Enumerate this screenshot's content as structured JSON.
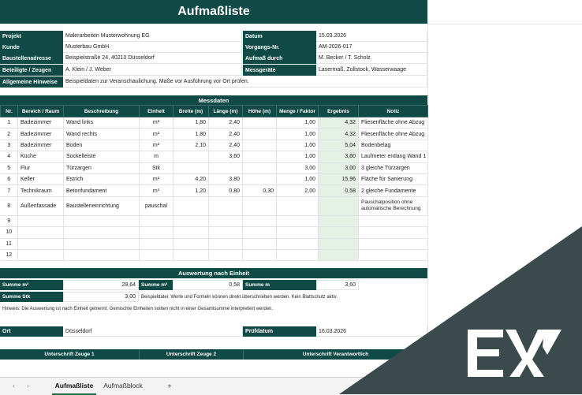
{
  "title": "Aufmaßliste",
  "info": {
    "left": [
      {
        "label": "Projekt",
        "value": "Malerarbeiten Musterwohnung EG"
      },
      {
        "label": "Kunde",
        "value": "Musterbau GmbH"
      },
      {
        "label": "Baustellenadresse",
        "value": "Beispielstraße 24, 40210 Düsseldorf"
      },
      {
        "label": "Beteiligte / Zeugen",
        "value": "A. Klein / J. Weber"
      }
    ],
    "right": [
      {
        "label": "Datum",
        "value": "15.03.2026"
      },
      {
        "label": "Vorgangs-Nr.",
        "value": "AM-2026-017"
      },
      {
        "label": "Aufmaß durch",
        "value": "M. Becker / T. Scholz"
      },
      {
        "label": "Messgeräte",
        "value": "Lasermaß, Zollstock, Wasserwaage"
      }
    ],
    "hinweise_label": "Allgemeine Hinweise",
    "hinweise_value": "Beispieldaten zur Veranschaulichung. Maße vor Ausführung vor Ort prüfen."
  },
  "messdaten": {
    "title": "Messdaten",
    "columns": [
      "Nr.",
      "Bereich / Raum",
      "Beschreibung",
      "Einheit",
      "Breite (m)",
      "Länge (m)",
      "Höhe (m)",
      "Menge / Faktor",
      "Ergebnis",
      "Notiz"
    ],
    "rows": [
      {
        "nr": "1",
        "bereich": "Badezimmer",
        "beschreibung": "Wand links",
        "einheit": "m²",
        "breite": "1,80",
        "laenge": "2,40",
        "hoehe": "",
        "menge": "1,00",
        "ergebnis": "4,32",
        "notiz": "Fliesenfläche ohne Abzug"
      },
      {
        "nr": "2",
        "bereich": "Badezimmer",
        "beschreibung": "Wand rechts",
        "einheit": "m²",
        "breite": "1,80",
        "laenge": "2,40",
        "hoehe": "",
        "menge": "1,00",
        "ergebnis": "4,32",
        "notiz": "Fliesenfläche ohne Abzug"
      },
      {
        "nr": "3",
        "bereich": "Badezimmer",
        "beschreibung": "Boden",
        "einheit": "m²",
        "breite": "2,10",
        "laenge": "2,40",
        "hoehe": "",
        "menge": "1,00",
        "ergebnis": "5,04",
        "notiz": "Bodenbelag"
      },
      {
        "nr": "4",
        "bereich": "Küche",
        "beschreibung": "Sockelleiste",
        "einheit": "m",
        "breite": "",
        "laenge": "3,60",
        "hoehe": "",
        "menge": "1,00",
        "ergebnis": "3,60",
        "notiz": "Laufmeter entlang Wand 1"
      },
      {
        "nr": "5",
        "bereich": "Flur",
        "beschreibung": "Türzargen",
        "einheit": "Stk",
        "breite": "",
        "laenge": "",
        "hoehe": "",
        "menge": "3,00",
        "ergebnis": "3,00",
        "notiz": "3 gleiche Türzargen"
      },
      {
        "nr": "6",
        "bereich": "Keller",
        "beschreibung": "Estrich",
        "einheit": "m²",
        "breite": "4,20",
        "laenge": "3,80",
        "hoehe": "",
        "menge": "1,00",
        "ergebnis": "15,96",
        "notiz": "Fläche für Sanierung"
      },
      {
        "nr": "7",
        "bereich": "Technikraum",
        "beschreibung": "Betonfundament",
        "einheit": "m³",
        "breite": "1,20",
        "laenge": "0,80",
        "hoehe": "0,30",
        "menge": "2,00",
        "ergebnis": "0,58",
        "notiz": "2 gleiche Fundamente"
      },
      {
        "nr": "8",
        "bereich": "Außenfassade",
        "beschreibung": "Baustelleneinrichtung",
        "einheit": "pauschal",
        "breite": "",
        "laenge": "",
        "hoehe": "",
        "menge": "",
        "ergebnis": "",
        "notiz": "Pauschalposition ohne automatische Berechnung"
      },
      {
        "nr": "9",
        "bereich": "",
        "beschreibung": "",
        "einheit": "",
        "breite": "",
        "laenge": "",
        "hoehe": "",
        "menge": "",
        "ergebnis": "",
        "notiz": ""
      },
      {
        "nr": "10",
        "bereich": "",
        "beschreibung": "",
        "einheit": "",
        "breite": "",
        "laenge": "",
        "hoehe": "",
        "menge": "",
        "ergebnis": "",
        "notiz": ""
      },
      {
        "nr": "11",
        "bereich": "",
        "beschreibung": "",
        "einheit": "",
        "breite": "",
        "laenge": "",
        "hoehe": "",
        "menge": "",
        "ergebnis": "",
        "notiz": ""
      },
      {
        "nr": "12",
        "bereich": "",
        "beschreibung": "",
        "einheit": "",
        "breite": "",
        "laenge": "",
        "hoehe": "",
        "menge": "",
        "ergebnis": "",
        "notiz": ""
      }
    ]
  },
  "auswertung": {
    "title": "Auswertung nach Einheit",
    "summe_m2_label": "Summe m²",
    "summe_m2_value": "29,64",
    "summe_m3_label": "Summe m³",
    "summe_m3_value": "0,58",
    "summe_m_label": "Summe m",
    "summe_m_value": "3,60",
    "summe_stk_label": "Summe Stk",
    "summe_stk_value": "3,00",
    "beispiel_note": "Beispieldatei: Werte und Formeln können direkt überschrieben werden. Kein Blattschutz aktiv.",
    "hinweis": "Hinweis: Die Auswertung ist nach Einheit getrennt. Gemischte Einheiten sollten nicht in einer Gesamtsumme interpretiert werden."
  },
  "footer": {
    "ort_label": "Ort",
    "ort_value": "Düsseldorf",
    "pruefdatum_label": "Prüfdatum",
    "pruefdatum_value": "16.03.2026",
    "sig1": "Unterschrift Zeuge 1",
    "sig2": "Unterschrift Zeuge 2",
    "sig3": "Unterschrift Verantwortlich"
  },
  "tabs": {
    "active": "Aufmaßliste",
    "other": "Aufmaßblock",
    "add": "+"
  },
  "icons": {
    "prev": "chevron-left-icon",
    "next": "chevron-right-icon",
    "brand": "ex-logo"
  },
  "colors": {
    "header": "#0f4a47",
    "result": "#e4f1e4",
    "overlay": "#3a4a4d"
  }
}
